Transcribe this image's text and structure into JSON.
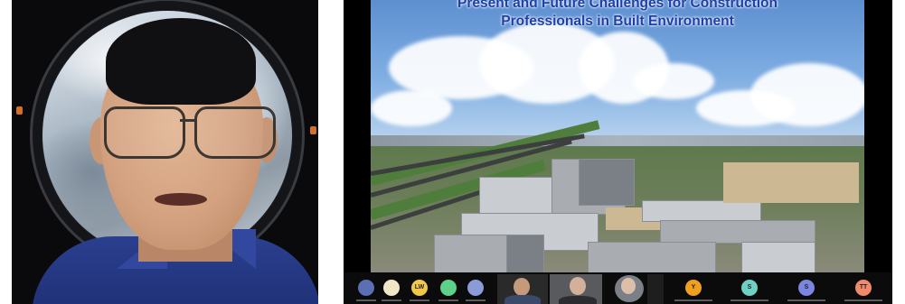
{
  "speaker_panel": {
    "background": "porthole window with Earth view"
  },
  "shared_slide": {
    "title_line_1": "Present and Future Challenges for Construction",
    "title_line_2": "Professionals in Built Environment",
    "title_color": "#1f3fa8"
  },
  "participant_strip": {
    "avatars": [
      {
        "initials": "",
        "color": "#5b6fb5"
      },
      {
        "initials": "",
        "color": "#f1e7c6"
      },
      {
        "initials": "LW",
        "color": "#f2c84b"
      },
      {
        "initials": "",
        "color": "#5fd08a"
      },
      {
        "initials": "",
        "color": "#8a9bd8"
      },
      {
        "initials": "Y",
        "color": "#f0a020"
      },
      {
        "initials": "S",
        "color": "#6fd0c4"
      },
      {
        "initials": "S",
        "color": "#7b86e0"
      },
      {
        "initials": "TT",
        "color": "#f08a6a"
      }
    ]
  }
}
